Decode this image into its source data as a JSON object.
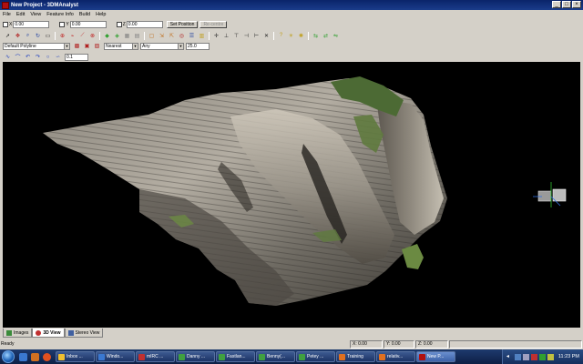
{
  "window": {
    "title": "New Project - 3DMAnalyst"
  },
  "menu": [
    "File",
    "Edit",
    "View",
    "Feature Info",
    "Build",
    "Help"
  ],
  "coords": {
    "x_label": "X",
    "x_value": "0.00",
    "y_label": "Y",
    "y_value": "0.00",
    "z_label": "Z",
    "z_value": "0.00",
    "set_position": "Set Position",
    "re_centre": "Re-centre"
  },
  "feature_toolbar": {
    "style_select": "Default Polyline",
    "snap_select": "Nearest",
    "layer_select": "Any",
    "size_value": "25.0"
  },
  "curve_toolbar": {
    "value": "0.1"
  },
  "tabs": [
    {
      "label": "Images"
    },
    {
      "label": "3D View"
    },
    {
      "label": "Stereo View"
    }
  ],
  "status": {
    "ready": "Ready",
    "x": "X: 0.00",
    "y": "Y: 0.00",
    "z": "Z: 0.00"
  },
  "taskbar": {
    "items": [
      {
        "label": "Inbox ...",
        "color": "#f0c030"
      },
      {
        "label": "Windo...",
        "color": "#3a78d0"
      },
      {
        "label": "mIRC ...",
        "color": "#c03030"
      },
      {
        "label": "Danny ...",
        "color": "#40a040"
      },
      {
        "label": "Fastlan...",
        "color": "#40a040"
      },
      {
        "label": "Benny(...",
        "color": "#40a040"
      },
      {
        "label": "Petey ...",
        "color": "#40a040"
      },
      {
        "label": "Training",
        "color": "#e07020"
      },
      {
        "label": "relativ...",
        "color": "#e07020"
      },
      {
        "label": "New P...",
        "color": "#b01010"
      }
    ],
    "clock": "11:23 PM"
  },
  "colors": {
    "titlebar": "#0a246a",
    "viewport_bg": "#000000",
    "rock_light": "#b8b2a8",
    "rock_dark": "#4a4640",
    "vegetation": "#4c6a34"
  }
}
